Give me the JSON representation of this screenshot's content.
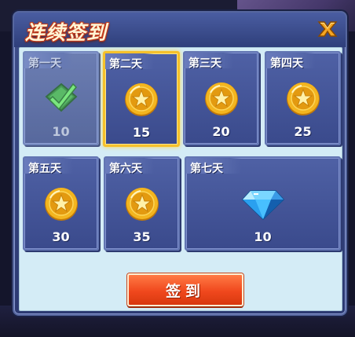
{
  "dialog": {
    "title": "连续签到",
    "close_icon": "close-x-icon"
  },
  "days": [
    {
      "label": "第一天",
      "amount": "10",
      "reward_icon": "checkmark-claimed-icon",
      "state": "claimed"
    },
    {
      "label": "第二天",
      "amount": "15",
      "reward_icon": "gold-coin-icon",
      "state": "today"
    },
    {
      "label": "第三天",
      "amount": "20",
      "reward_icon": "gold-coin-icon",
      "state": "upcoming"
    },
    {
      "label": "第四天",
      "amount": "25",
      "reward_icon": "gold-coin-icon",
      "state": "upcoming"
    },
    {
      "label": "第五天",
      "amount": "30",
      "reward_icon": "gold-coin-icon",
      "state": "upcoming"
    },
    {
      "label": "第六天",
      "amount": "35",
      "reward_icon": "gold-coin-icon",
      "state": "upcoming"
    },
    {
      "label": "第七天",
      "amount": "10",
      "reward_icon": "blue-diamond-icon",
      "state": "upcoming"
    }
  ],
  "sign_button": {
    "label": "签到"
  },
  "colors": {
    "panel_bg": "#d4ecf6",
    "card_bg": "#4f61a5",
    "highlight_border": "#f6c12b",
    "button_bg": "#f0481d",
    "title_outline": "#c23a1b"
  }
}
